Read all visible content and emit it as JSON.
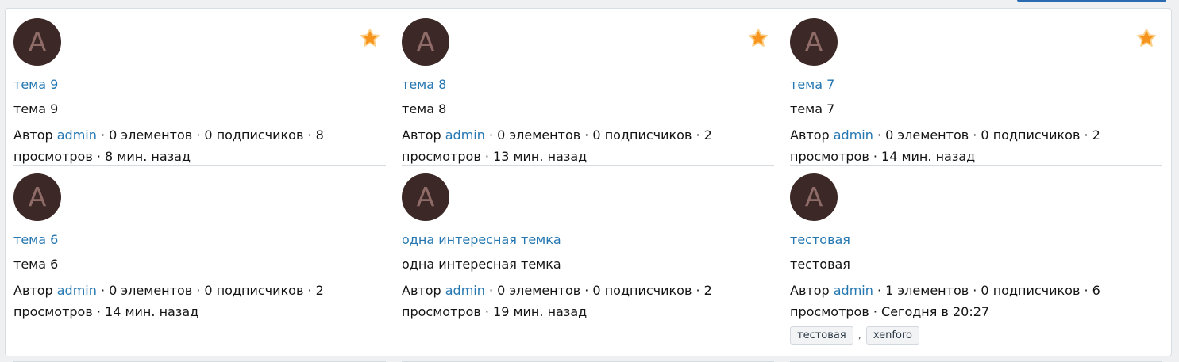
{
  "colors": {
    "link": "#2577b1",
    "avatar_bg": "#3c2826",
    "avatar_fg": "#8f6c68",
    "star": "#f7941d"
  },
  "cards": [
    {
      "avatar_letter": "A",
      "title": "тема 9",
      "description": "тема 9",
      "author_prefix": "Автор",
      "author": "admin",
      "stats": " · 0 элементов · 0 подписчиков · 8 просмотров · 8 мин. назад",
      "starred": true
    },
    {
      "avatar_letter": "A",
      "title": "тема 8",
      "description": "тема 8",
      "author_prefix": "Автор",
      "author": "admin",
      "stats": " · 0 элементов · 0 подписчиков · 2 просмотров · 13 мин. назад",
      "starred": true
    },
    {
      "avatar_letter": "A",
      "title": "тема 7",
      "description": "тема 7",
      "author_prefix": "Автор",
      "author": "admin",
      "stats": " · 0 элементов · 0 подписчиков · 2 просмотров · 14 мин. назад",
      "starred": true
    },
    {
      "avatar_letter": "A",
      "title": "тема 6",
      "description": "тема 6",
      "author_prefix": "Автор",
      "author": "admin",
      "stats": " · 0 элементов · 0 подписчиков · 2 просмотров · 14 мин. назад",
      "starred": false
    },
    {
      "avatar_letter": "A",
      "title": "одна интересная темка",
      "description": "одна интересная темка",
      "author_prefix": "Автор",
      "author": "admin",
      "stats": " · 0 элементов · 0 подписчиков · 2 просмотров · 19 мин. назад",
      "starred": false
    },
    {
      "avatar_letter": "A",
      "title": "тестовая",
      "description": "тестовая",
      "author_prefix": "Автор",
      "author": "admin",
      "stats": " · 1 элементов · 0 подписчиков · 6 просмотров · Сегодня в 20:27",
      "starred": false,
      "tags": [
        "тестовая",
        "xenforo"
      ],
      "tag_separator": ","
    }
  ]
}
